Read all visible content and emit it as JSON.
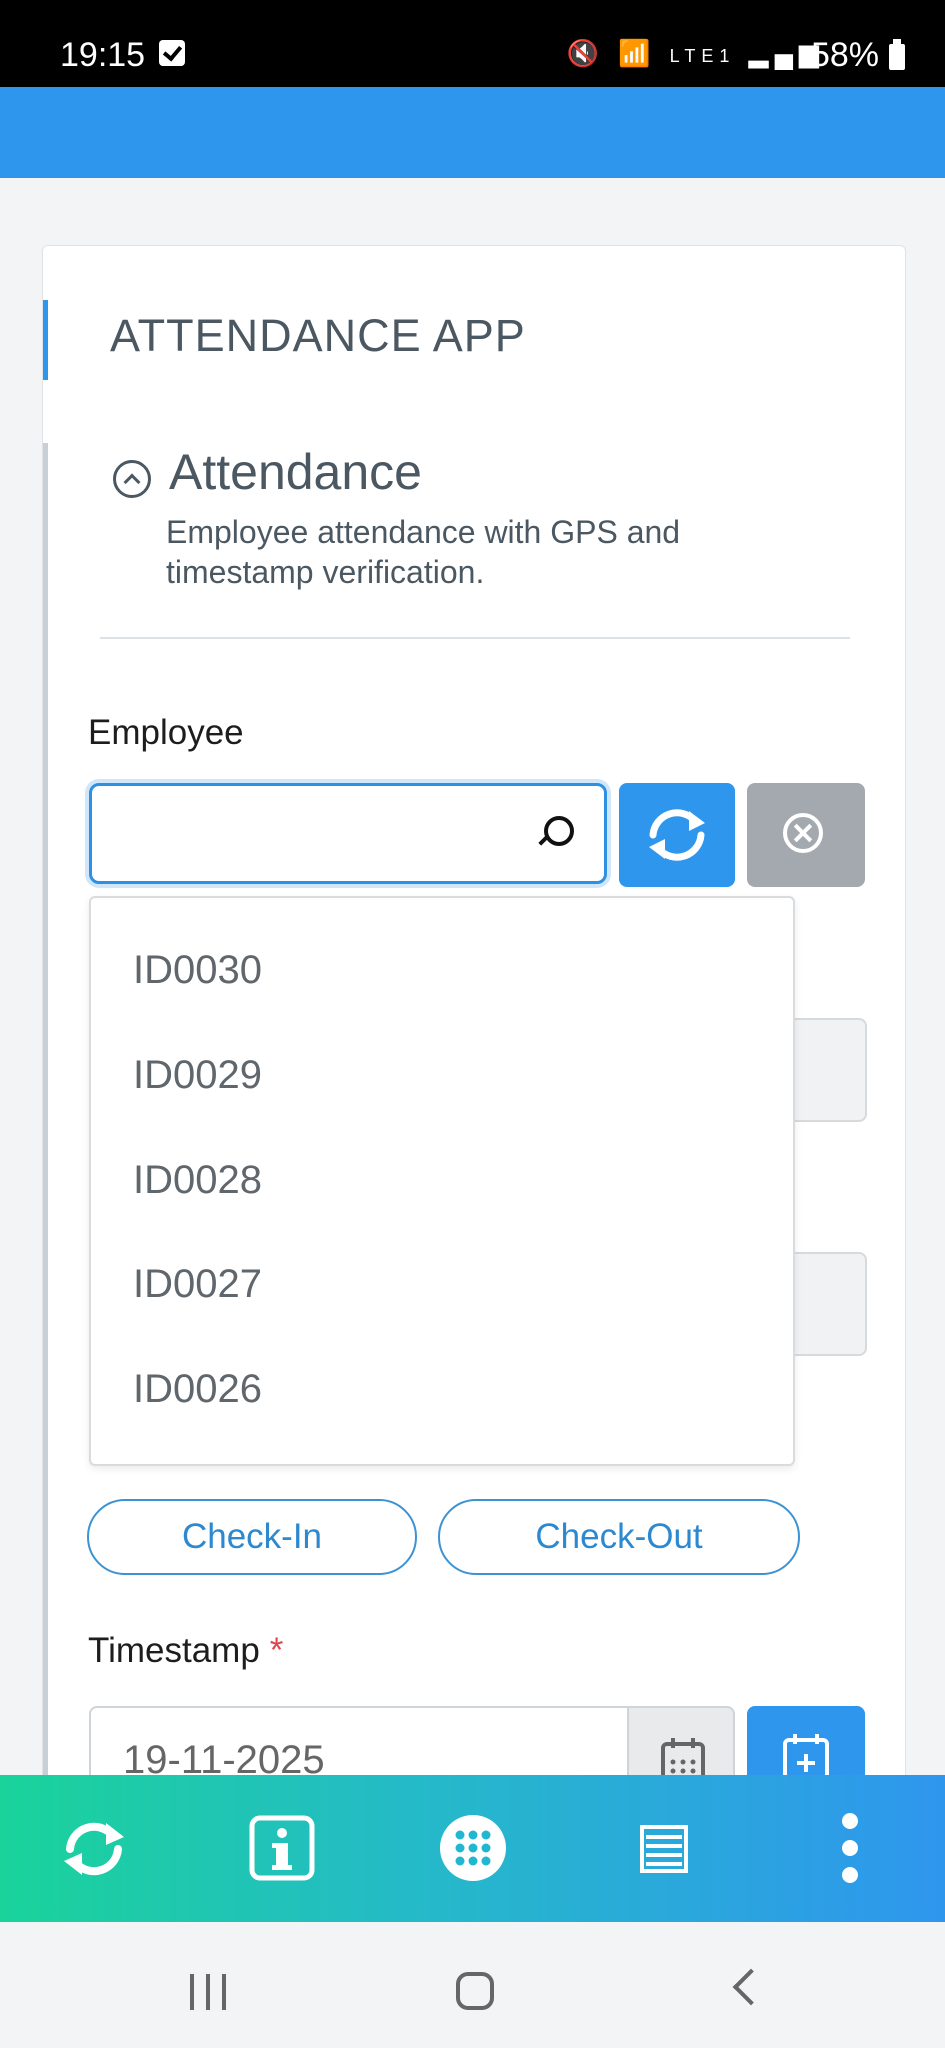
{
  "status_bar": {
    "time": "19:15",
    "network": "LTE1",
    "battery": "58%"
  },
  "card": {
    "title": "ATTENDANCE APP"
  },
  "section": {
    "title": "Attendance",
    "description": "Employee attendance with GPS and timestamp verification."
  },
  "employee_field": {
    "label": "Employee",
    "value": "",
    "placeholder": ""
  },
  "dropdown": {
    "options": [
      "ID0030",
      "ID0029",
      "ID0028",
      "ID0027",
      "ID0026"
    ]
  },
  "actions": {
    "check_in": "Check-In",
    "check_out": "Check-Out"
  },
  "timestamp_field": {
    "label": "Timestamp",
    "required_mark": "*",
    "value": "19-11-2025"
  },
  "toolbar": {
    "icons": [
      "refresh-icon",
      "info-icon",
      "apps-grid-icon",
      "list-icon",
      "more-vertical-icon"
    ]
  },
  "colors": {
    "primary": "#2f96ee",
    "toolbar_gradient_start": "#1ad39a",
    "toolbar_gradient_end": "#2f96ee",
    "required": "#e0474c",
    "clear_button": "#a4a9af"
  }
}
